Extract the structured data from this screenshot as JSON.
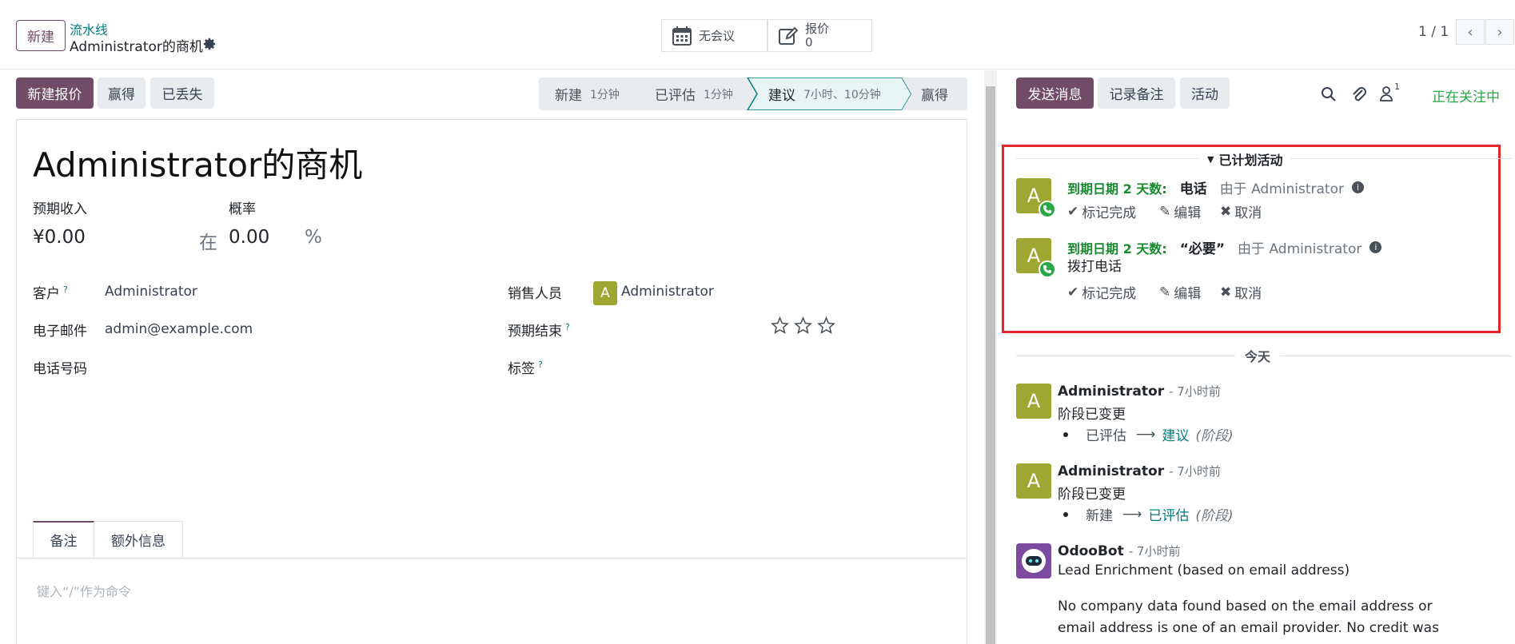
{
  "control_panel": {
    "new_button": "新建",
    "breadcrumb_parent": "流水线",
    "breadcrumb_current": "Administrator的商机",
    "meeting_button": "无会议",
    "quotation_label": "报价",
    "quotation_count": "0",
    "pager": "1 / 1"
  },
  "header": {
    "new_quotation": "新建报价",
    "won": "赢得",
    "lost": "已丢失",
    "stages": [
      {
        "name": "新建",
        "duration": "1分钟"
      },
      {
        "name": "已评估",
        "duration": "1分钟"
      },
      {
        "name": "建议",
        "duration": "7小时、10分钟"
      },
      {
        "name": "赢得",
        "duration": ""
      }
    ]
  },
  "form": {
    "title": "Administrator的商机",
    "expected_revenue_label": "预期收入",
    "expected_revenue": "¥0.00",
    "probability_label": "概率",
    "at_label": "在",
    "probability": "0.00",
    "percent": "%",
    "customer_label": "客户",
    "customer": "Administrator",
    "email_label": "电子邮件",
    "email": "admin@example.com",
    "phone_label": "电话号码",
    "salesperson_label": "销售人员",
    "salesperson_initial": "A",
    "salesperson": "Administrator",
    "expected_closing_label": "预期结束",
    "tags_label": "标签",
    "help_mark": "?",
    "tabs": [
      "备注",
      "额外信息"
    ],
    "notes_placeholder": "键入“/”作为命令"
  },
  "chatter": {
    "send_message": "发送消息",
    "log_note": "记录备注",
    "activities": "活动",
    "followers_count": "1",
    "following": "正在关注中",
    "planned_section": "已计划活动",
    "planned": [
      {
        "initial": "A",
        "due": "到期日期 2 天数:",
        "type": "电话",
        "by": "由于 Administrator",
        "note": ""
      },
      {
        "initial": "A",
        "due": "到期日期 2 天数:",
        "type": "“必要”",
        "by": "由于 Administrator",
        "note": "拨打电话"
      }
    ],
    "mark_done": "标记完成",
    "edit": "编辑",
    "cancel": "取消",
    "today": "今天",
    "messages": [
      {
        "author": "Administrator",
        "time": "- 7小时前",
        "text": "阶段已变更",
        "old": "已评估",
        "new": "建议",
        "field": "(阶段)"
      },
      {
        "author": "Administrator",
        "time": "- 7小时前",
        "text": "阶段已变更",
        "old": "新建",
        "new": "已评估",
        "field": "(阶段)"
      }
    ],
    "bot": {
      "author": "OdooBot",
      "time": "- 7小时前",
      "line1": "Lead Enrichment (based on email address)",
      "line2": "No company data found based on the email address or",
      "line3": "email address is one of an email provider. No credit was"
    }
  }
}
